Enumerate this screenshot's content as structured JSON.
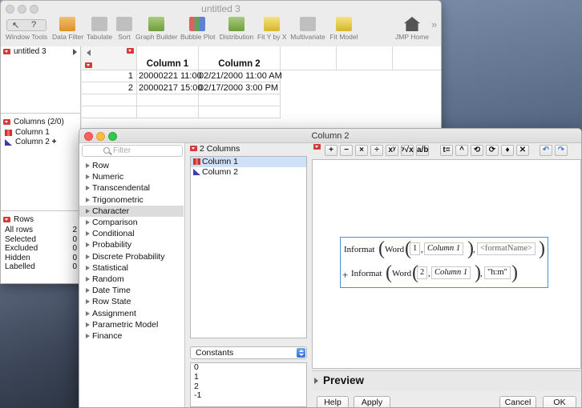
{
  "back_window": {
    "title": "untitled 3",
    "toolbar": [
      {
        "label": "Window Tools",
        "icon": "window-tools-icon"
      },
      {
        "label": "Data Filter",
        "icon": "data-filter-icon"
      },
      {
        "label": "Tabulate",
        "icon": "tabulate-icon"
      },
      {
        "label": "Sort",
        "icon": "sort-icon"
      },
      {
        "label": "Graph Builder",
        "icon": "graph-builder-icon"
      },
      {
        "label": "Bubble Plot",
        "icon": "bubble-plot-icon"
      },
      {
        "label": "Distribution",
        "icon": "distribution-icon"
      },
      {
        "label": "Fit Y by X",
        "icon": "fit-y-by-x-icon"
      },
      {
        "label": "Multivariate",
        "icon": "multivariate-icon"
      },
      {
        "label": "Fit Model",
        "icon": "fit-model-icon"
      },
      {
        "label": "JMP Home",
        "icon": "home-icon"
      }
    ],
    "overflow_label": "»",
    "table_panel_title": "untitled 3",
    "columns_panel_title": "Columns (2/0)",
    "columns": [
      {
        "name": "Column 1",
        "type": "nominal"
      },
      {
        "name": "Column 2",
        "type": "continuous",
        "marker": "+"
      }
    ],
    "rows_panel_title": "Rows",
    "rows_stats": [
      {
        "label": "All rows",
        "value": "2"
      },
      {
        "label": "Selected",
        "value": "0"
      },
      {
        "label": "Excluded",
        "value": "0"
      },
      {
        "label": "Hidden",
        "value": "0"
      },
      {
        "label": "Labelled",
        "value": "0"
      }
    ],
    "grid": {
      "headers": [
        "Column 1",
        "Column 2"
      ],
      "rows": [
        {
          "n": "1",
          "c1": "20000221 11:00",
          "c2": "02/21/2000 11:00 AM"
        },
        {
          "n": "2",
          "c1": "20000217 15:00",
          "c2": "02/17/2000 3:00 PM"
        }
      ]
    }
  },
  "dialog": {
    "title": "Column 2",
    "filter_placeholder": "Filter",
    "function_categories": [
      "Row",
      "Numeric",
      "Transcendental",
      "Trigonometric",
      "Character",
      "Comparison",
      "Conditional",
      "Probability",
      "Discrete Probability",
      "Statistical",
      "Random",
      "Date Time",
      "Row State",
      "Assignment",
      "Parametric Model",
      "Finance"
    ],
    "selected_category": "Character",
    "columns_header": "2 Columns",
    "columns": [
      "Column 1",
      "Column 2"
    ],
    "constants_select": "Constants",
    "constants": [
      "0",
      "1",
      "2",
      "-1"
    ],
    "toolbar_ops": [
      "+",
      "−",
      "×",
      "÷",
      "xʸ",
      "ʸ√x",
      "a/b",
      "t=",
      "^",
      "⟲",
      "⟳",
      "♦",
      "✕"
    ],
    "formula": {
      "line1": {
        "fn": "Informat",
        "inner_fn": "Word",
        "n": "1",
        "col": "Column 1",
        "arg2": "<formatName>"
      },
      "line2": {
        "op": "+",
        "fn": "Informat",
        "inner_fn": "Word",
        "n": "2",
        "col": "Column 1",
        "arg2": "\"h:m\""
      }
    },
    "preview_label": "Preview",
    "buttons": {
      "help": "Help",
      "apply": "Apply",
      "cancel": "Cancel",
      "ok": "OK"
    }
  }
}
